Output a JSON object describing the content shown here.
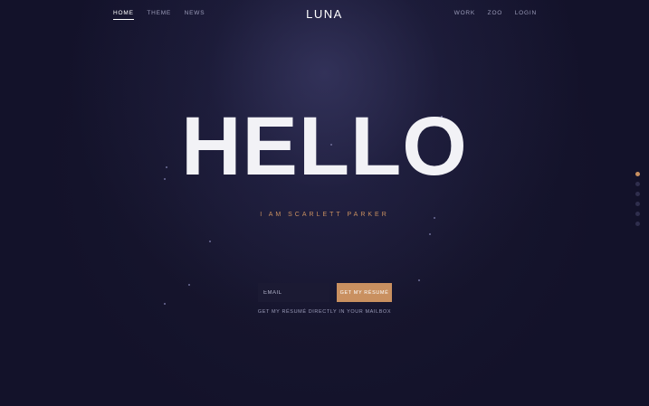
{
  "nav": {
    "left": [
      {
        "label": "HOME",
        "active": true
      },
      {
        "label": "THEME",
        "active": false
      },
      {
        "label": "NEWS",
        "active": false
      }
    ],
    "right": [
      {
        "label": "WORK"
      },
      {
        "label": "ZOO"
      },
      {
        "label": "LOGIN"
      }
    ]
  },
  "logo": "LUNA",
  "hero": {
    "title": "HELLO",
    "subtitle": "I AM SCARLETT PARKER"
  },
  "signup": {
    "email_placeholder": "EMAIL",
    "button_label": "GET MY RÉSUMÉ",
    "caption": "GET MY RÉSUMÉ DIRECTLY IN YOUR MAILBOX"
  },
  "pagination": {
    "count": 6,
    "active_index": 0
  },
  "colors": {
    "accent": "#c99060",
    "background": "#14132a"
  }
}
